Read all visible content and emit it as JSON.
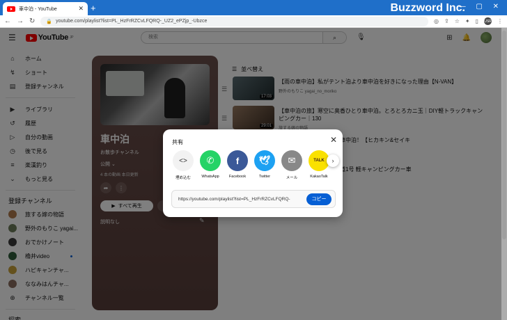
{
  "browser": {
    "tab_title": "車中泊 - YouTube",
    "tab_close": "✕",
    "new_tab": "+",
    "brand": "Buzzword Inc.",
    "window_controls": "— ▢ ✕",
    "url": "youtube.com/playlist?list=PL_HzFrRZCvLFQRQ-_UZ2_ePZjp_-Ubzce",
    "profile_initials": "USR"
  },
  "youtube": {
    "logo_text": "YouTube",
    "logo_sup": "JP",
    "search_placeholder": "検索"
  },
  "sidebar": {
    "items": [
      {
        "icon": "⌂",
        "label": "ホーム"
      },
      {
        "icon": "↯",
        "label": "ショート"
      },
      {
        "icon": "▤",
        "label": "登録チャンネル"
      }
    ],
    "library": [
      {
        "icon": "▶",
        "label": "ライブラリ"
      },
      {
        "icon": "↺",
        "label": "履歴"
      },
      {
        "icon": "▷",
        "label": "自分の動画"
      },
      {
        "icon": "◷",
        "label": "後で見る"
      },
      {
        "icon": "≡",
        "label": "楽漢釣り"
      },
      {
        "icon": "⌄",
        "label": "もっと見る"
      }
    ],
    "subs_heading": "登録チャンネル",
    "subs": [
      {
        "label": "旅する嫁の物語",
        "color": "#b07a4c",
        "dot": true
      },
      {
        "label": "野外のもりこ yagai...",
        "color": "#6d7d5a",
        "dot": false
      },
      {
        "label": "おでかけノート",
        "color": "#3b3b3b",
        "dot": false
      },
      {
        "label": "櫓井video",
        "color": "#2f5d3a",
        "dot": true
      },
      {
        "label": "ハピキャンチャ...",
        "color": "#c9a23a",
        "dot": true
      },
      {
        "label": "ななみはんチャ...",
        "color": "#8a6d5e",
        "dot": true
      }
    ],
    "channel_list": "チャンネル一覧",
    "explore": "探索"
  },
  "playlist": {
    "title": "車中泊",
    "channel": "お散歩チャンネル",
    "visibility": "公開 ⌄",
    "meta": "4 本の動画  本日更新",
    "play_all": "すべて再生",
    "play_icon": "▶",
    "shuffle": "",
    "description": "説明なし"
  },
  "sort_label": "並べ替え",
  "videos": [
    {
      "title": "【雨の車中泊】私がテント泊より車中泊を好きになった理由【N-VAN】",
      "channel": "野外のもりこ yagai_no_moriko",
      "duration": "17:03",
      "c1": "#5b6e74",
      "c2": "#1f2a2c"
    },
    {
      "title": "【車中泊の旅】寒空に奥香ひとり車中泊。とろとろカニ玉｜DIY軽トラックキャンピングカー｜130",
      "channel": "旅する嫁の物語",
      "duration": "29:01",
      "c1": "#9a7b62",
      "c2": "#3a2c22"
    },
    {
      "title": "初の軽キャンピングカー車中泊！【ヒカキン&セイキ",
      "channel": "",
      "duration": "",
      "c1": "#cfcfcf",
      "c2": "#cfcfcf"
    },
    {
      "title": "】大阪→東京下道のみ国道1号 軽キャンピングカー車\n京(ゴール)〜",
      "channel": "",
      "duration": "",
      "c1": "#cfcfcf",
      "c2": "#cfcfcf"
    }
  ],
  "share": {
    "title": "共有",
    "close": "✕",
    "options": [
      {
        "label": "埋め込む",
        "glyph": "<>",
        "bg": "#f2f2f2",
        "fg": "#333333"
      },
      {
        "label": "WhatsApp",
        "glyph": "✆",
        "bg": "#25d366",
        "fg": "#ffffff"
      },
      {
        "label": "Facebook",
        "glyph": "f",
        "bg": "#3b5998",
        "fg": "#ffffff"
      },
      {
        "label": "Twitter",
        "glyph": "🕊",
        "bg": "#1da1f2",
        "fg": "#ffffff"
      },
      {
        "label": "メール",
        "glyph": "✉",
        "bg": "#888888",
        "fg": "#ffffff"
      },
      {
        "label": "KakaoTalk",
        "glyph": "TALK",
        "bg": "#fae100",
        "fg": "#3c1e1e"
      }
    ],
    "next": "›",
    "link": "https://youtube.com/playlist?list=PL_HzFrRZCvLFQRQ-",
    "copy_label": "コピー"
  },
  "colors": {
    "accent": "#065fd4",
    "titlebar": "#1f6fc9",
    "card": "#5e4440"
  }
}
